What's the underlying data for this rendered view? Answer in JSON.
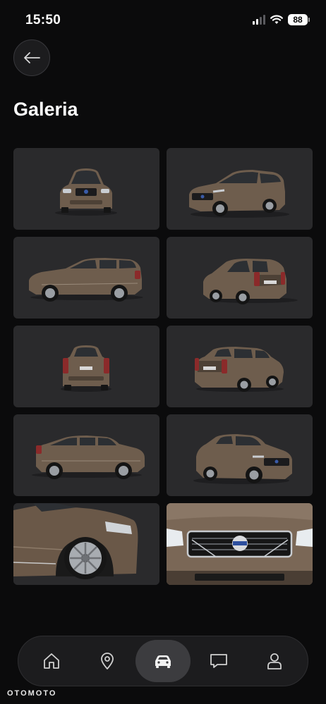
{
  "status_bar": {
    "time": "15:50",
    "battery": "88",
    "icons": [
      "cellular-signal-icon",
      "wifi-icon",
      "battery-icon"
    ]
  },
  "header": {
    "back_icon": "arrow-left-icon",
    "title": "Galeria"
  },
  "gallery": {
    "columns": 2,
    "images": [
      "car-front-view",
      "car-front-three-quarter-left",
      "car-side-profile-left",
      "car-rear-three-quarter-right",
      "car-rear-view",
      "car-rear-three-quarter-left",
      "car-side-profile-right",
      "car-front-three-quarter-right",
      "car-wheel-closeup",
      "car-grille-closeup"
    ]
  },
  "bottom_nav": {
    "items": [
      {
        "icon": "home-icon",
        "active": false
      },
      {
        "icon": "location-pin-icon",
        "active": false
      },
      {
        "icon": "car-icon",
        "active": true
      },
      {
        "icon": "chat-icon",
        "active": false
      },
      {
        "icon": "profile-icon",
        "active": false
      }
    ]
  },
  "watermark": "OTOMOTO",
  "colors": {
    "background": "#0b0b0c",
    "tile": "#2a2a2c",
    "car_body": "#6e5d4d",
    "nav_active": "#3c3c3f"
  }
}
